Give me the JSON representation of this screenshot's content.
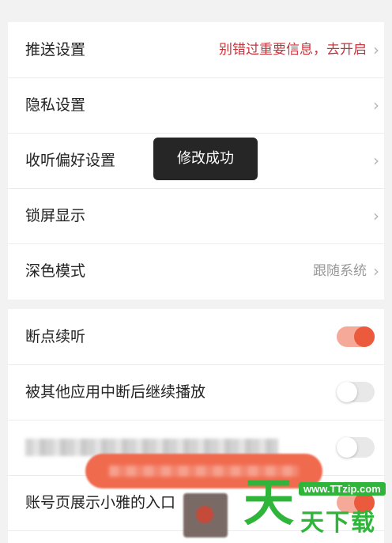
{
  "settings_group_1": [
    {
      "label": "推送设置",
      "value": "别错过重要信息，去开启",
      "value_color": "#c8333b"
    },
    {
      "label": "隐私设置",
      "value": ""
    },
    {
      "label": "收听偏好设置",
      "value": ""
    },
    {
      "label": "锁屏显示",
      "value": ""
    },
    {
      "label": "深色模式",
      "value": "跟随系统"
    }
  ],
  "settings_group_2": [
    {
      "label": "断点续听",
      "toggle": true
    },
    {
      "label": "被其他应用中断后继续播放",
      "toggle": false
    },
    {
      "label": "",
      "toggle": false
    },
    {
      "label": "账号页展示小雅的入口",
      "toggle": true
    }
  ],
  "toast": {
    "text": "修改成功"
  },
  "chevron_icon": "chevron-right",
  "accent_color": "#eb5a3c",
  "watermark": {
    "big": "天",
    "small": "天下载",
    "url": "www.TTzip.com"
  }
}
